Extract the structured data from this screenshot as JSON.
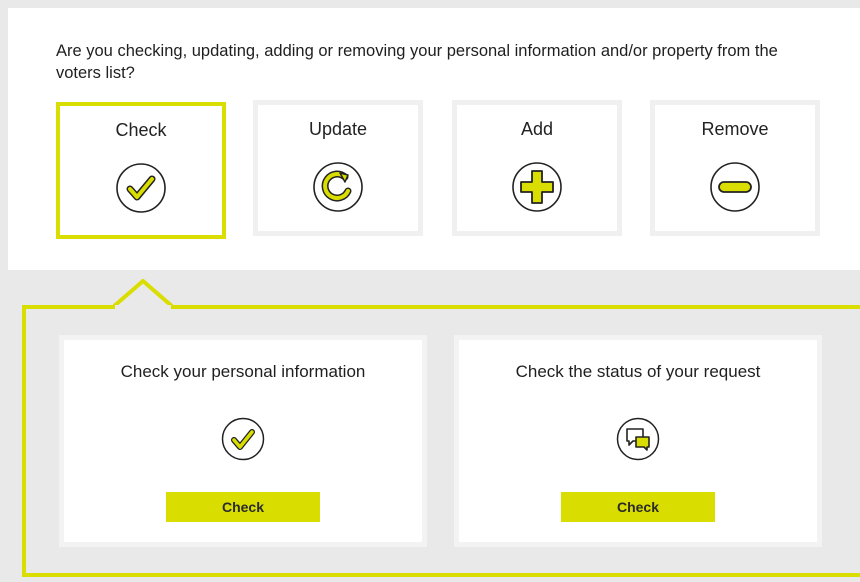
{
  "question": "Are you checking, updating, adding or removing your personal information and/or property from the voters list?",
  "options": [
    {
      "label": "Check",
      "icon": "checkmark-icon",
      "selected": true
    },
    {
      "label": "Update",
      "icon": "refresh-icon",
      "selected": false
    },
    {
      "label": "Add",
      "icon": "plus-icon",
      "selected": false
    },
    {
      "label": "Remove",
      "icon": "minus-icon",
      "selected": false
    }
  ],
  "cards": [
    {
      "title": "Check your personal information",
      "icon": "checkmark-icon",
      "button_label": "Check"
    },
    {
      "title": "Check the status of your request",
      "icon": "chat-bubbles-icon",
      "button_label": "Check"
    }
  ],
  "colors": {
    "accent": "#d9de00",
    "panel_border": "#f0f0f0",
    "background": "#e9e9e9"
  }
}
